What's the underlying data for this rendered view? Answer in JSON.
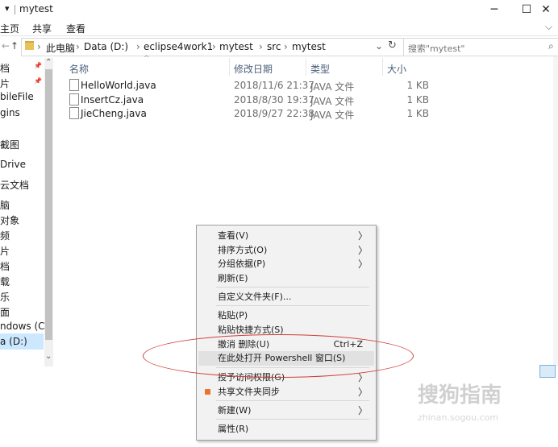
{
  "window": {
    "title": "mytest",
    "quick_access_glyph": "▾",
    "minimize": "─",
    "maximize": "☐",
    "close": "✕",
    "expand_ribbon": "⌵"
  },
  "ribbon": {
    "tabs": [
      "主页",
      "共享",
      "查看"
    ]
  },
  "address": {
    "back": "←",
    "up": "↑",
    "breadcrumbs": [
      "此电脑",
      "Data (D:)",
      "eclipse4work1",
      "mytest",
      "src",
      "mytest"
    ],
    "separator": "›",
    "dropdown": "⌄",
    "refresh": "↻",
    "search_placeholder": "搜索\"mytest\"",
    "search_icon": "⌕"
  },
  "nav": {
    "items": [
      "档",
      "片",
      "bileFile",
      "gins",
      "",
      "截图",
      "Drive",
      "云文档",
      "脑",
      "对象",
      "频",
      "片",
      "档",
      "载",
      "乐",
      "面",
      "ndows (C:)",
      "a (D:)"
    ],
    "pin": "📌",
    "scroll_up": "⌃",
    "scroll_down": "⌄"
  },
  "columns": {
    "name": "名称",
    "date": "修改日期",
    "type": "类型",
    "size": "大小"
  },
  "files": [
    {
      "name": "HelloWorld.java",
      "date": "2018/11/6 21:37",
      "type": "JAVA 文件",
      "size": "1 KB"
    },
    {
      "name": "InsertCz.java",
      "date": "2018/8/30 19:37",
      "type": "JAVA 文件",
      "size": "1 KB"
    },
    {
      "name": "JieCheng.java",
      "date": "2018/9/27 22:38",
      "type": "JAVA 文件",
      "size": "1 KB"
    }
  ],
  "context_menu": {
    "view": "查看(V)",
    "sort": "排序方式(O)",
    "group": "分组依据(P)",
    "refresh": "刷新(E)",
    "customize": "自定义文件夹(F)...",
    "paste": "粘贴(P)",
    "paste_shortcut": "粘贴快捷方式(S)",
    "undo": "撤消 删除(U)",
    "undo_shortcut": "Ctrl+Z",
    "powershell": "在此处打开 Powershell 窗口(S)",
    "grant_access": "授予访问权限(G)",
    "share_sync": "共享文件夹同步",
    "new": "新建(W)",
    "properties": "属性(R)",
    "submenu_arrow": "〉"
  },
  "watermark": {
    "brand": "搜狗指南",
    "url": "zhinan.sogou.com"
  },
  "colors": {
    "annotation": "#d23b3b",
    "accent": "#0078d7"
  }
}
